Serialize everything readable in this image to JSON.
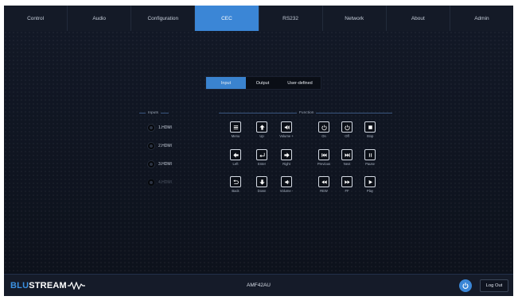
{
  "nav": {
    "tabs": [
      {
        "label": "Control"
      },
      {
        "label": "Audio"
      },
      {
        "label": "Configuration"
      },
      {
        "label": "CEC",
        "active": true
      },
      {
        "label": "RS232"
      },
      {
        "label": "Network"
      },
      {
        "label": "About"
      },
      {
        "label": "Admin"
      }
    ]
  },
  "cec": {
    "modes": [
      {
        "label": "Input",
        "active": true
      },
      {
        "label": "Output"
      },
      {
        "label": "User-defined"
      }
    ],
    "inputs_heading": "Inputs",
    "inputs": [
      {
        "label": "1.HDMI"
      },
      {
        "label": "2.HDMI"
      },
      {
        "label": "3.HDMI"
      },
      {
        "label": "4.HDMI",
        "disabled": true
      }
    ],
    "function_heading": "Function",
    "functions": [
      {
        "label": "Menu",
        "icon": "menu-icon"
      },
      {
        "label": "Up",
        "icon": "arrow-up-icon"
      },
      {
        "label": "Volume +",
        "icon": "volume-up-icon"
      },
      {
        "label": "On",
        "icon": "power-on-icon"
      },
      {
        "label": "Off",
        "icon": "power-off-icon"
      },
      {
        "label": "Stop",
        "icon": "stop-icon"
      },
      {
        "label": "Left",
        "icon": "arrow-left-icon"
      },
      {
        "label": "Enter",
        "icon": "enter-icon"
      },
      {
        "label": "Right",
        "icon": "arrow-right-icon"
      },
      {
        "label": "Previous",
        "icon": "previous-icon"
      },
      {
        "label": "Next",
        "icon": "next-icon"
      },
      {
        "label": "Pause",
        "icon": "pause-icon"
      },
      {
        "label": "Back",
        "icon": "back-icon"
      },
      {
        "label": "Down",
        "icon": "arrow-down-icon"
      },
      {
        "label": "Volume -",
        "icon": "volume-down-icon"
      },
      {
        "label": "REW",
        "icon": "rewind-icon"
      },
      {
        "label": "FF",
        "icon": "fast-forward-icon"
      },
      {
        "label": "Play",
        "icon": "play-icon"
      }
    ]
  },
  "footer": {
    "brand_blue": "BLU",
    "brand_white": "STREAM",
    "model": "AMF42AU",
    "logout_label": "Log Out"
  },
  "colors": {
    "accent": "#3b86d6",
    "nav_bg": "#141a27",
    "panel_bg": "#0f1420"
  }
}
